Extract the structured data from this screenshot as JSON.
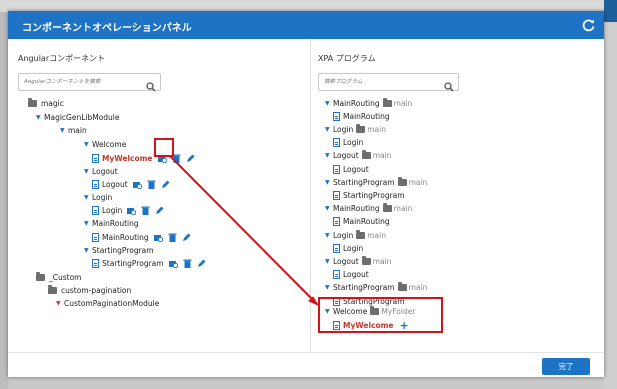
{
  "dialog": {
    "title": "コンポーネントオペレーションパネル",
    "refresh_icon": "refresh-icon"
  },
  "left": {
    "title": "Angularコンポーネント",
    "search_placeholder": "Angularコンポーネントを検索",
    "tree": {
      "magic": "magic",
      "module": "MagicGenLibModule",
      "main": "main",
      "welcome": "Welcome",
      "my_welcome": "MyWelcome",
      "logout": "Logout",
      "logout_comp": "Logout",
      "login": "Login",
      "login_comp": "Login",
      "main_routing": "MainRouting",
      "main_routing_comp": "MainRouting",
      "starting_program": "StartingProgram",
      "starting_program_comp": "StartingProgram",
      "custom": "_Custom",
      "custom_pagination": "custom-pagination",
      "custom_pagination_module": "CustomPaginationModule"
    }
  },
  "right": {
    "title": "XPA プログラム",
    "search_placeholder": "検索プログラム",
    "tree": [
      {
        "name": "MainRouting",
        "folder": "main",
        "child": "MainRouting"
      },
      {
        "name": "Login",
        "folder": "main",
        "child": "Login"
      },
      {
        "name": "Logout",
        "folder": "main",
        "child": "Logout"
      },
      {
        "name": "StartingProgram",
        "folder": "main",
        "child": "StartingProgram"
      },
      {
        "name": "MainRouting",
        "folder": "main",
        "child": "MainRouting"
      },
      {
        "name": "Login",
        "folder": "main",
        "child": "Login"
      },
      {
        "name": "Logout",
        "folder": "main",
        "child": "Logout"
      },
      {
        "name": "StartingProgram",
        "folder": "main",
        "child": "StartingProgram"
      }
    ],
    "welcome": {
      "name": "Welcome",
      "folder": "MyFolder",
      "child": "MyWelcome",
      "add": "+"
    }
  },
  "footer": {
    "done_label": "完了"
  },
  "colors": {
    "accent": "#1e73c4",
    "highlight": "#d0141e",
    "unmapped": "#c0392b"
  }
}
